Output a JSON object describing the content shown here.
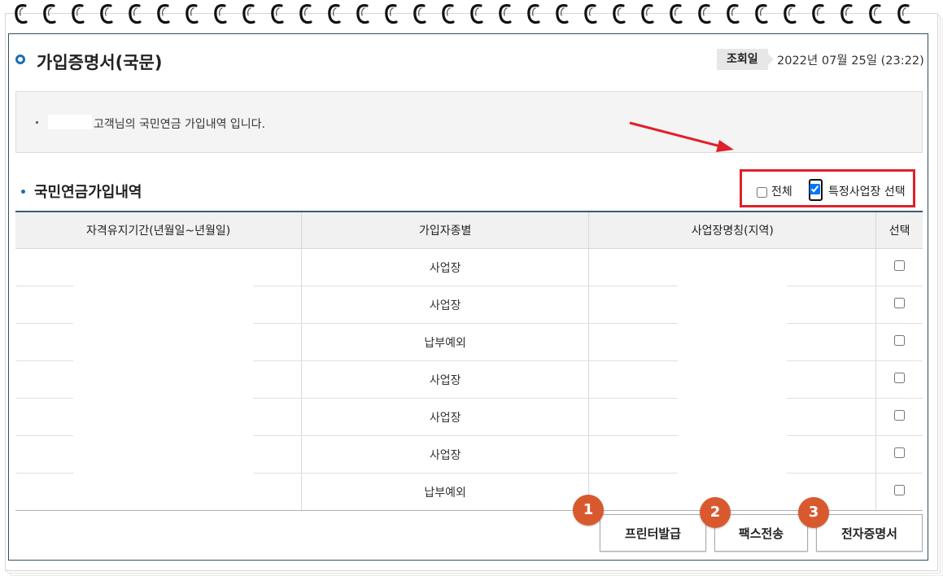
{
  "header": {
    "title": "가입증명서(국문)",
    "query_label": "조회일",
    "query_date": "2022년 07월 25일 (23:22)"
  },
  "info": {
    "text": "고객님의 국민연금 가입내역 입니다."
  },
  "section": {
    "title": "국민연금가입내역"
  },
  "filter": {
    "all_label": "전체",
    "all_checked": false,
    "specific_label": "특정사업장 선택",
    "specific_checked": true
  },
  "table": {
    "headers": [
      "자격유지기간(년월일~년월일)",
      "가입자종별",
      "사업장명칭(지역)",
      "선택"
    ],
    "rows": [
      {
        "period": "",
        "type": "사업장",
        "workplace": "",
        "selected": false
      },
      {
        "period": "",
        "type": "사업장",
        "workplace": "",
        "selected": false
      },
      {
        "period": "",
        "type": "납부예외",
        "workplace": "",
        "selected": false
      },
      {
        "period": "",
        "type": "사업장",
        "workplace": "",
        "selected": false
      },
      {
        "period": "",
        "type": "사업장",
        "workplace": "",
        "selected": false
      },
      {
        "period": "",
        "type": "사업장",
        "workplace": "",
        "selected": false
      },
      {
        "period": "",
        "type": "납부예외",
        "workplace": "",
        "selected": false
      }
    ]
  },
  "buttons": {
    "print": "프린터발급",
    "fax": "팩스전송",
    "electronic": "전자증명서"
  },
  "badges": [
    "1",
    "2",
    "3"
  ],
  "colors": {
    "accent": "#1a6fb0",
    "highlight": "#e0202a",
    "badge": "#d9592e",
    "table_rule": "#3d5a80"
  }
}
